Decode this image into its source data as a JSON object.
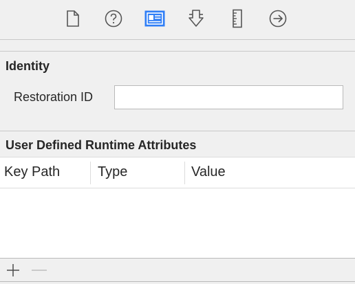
{
  "toolbar": {
    "icons": [
      {
        "name": "file-inspector-icon"
      },
      {
        "name": "quick-help-icon"
      },
      {
        "name": "identity-inspector-icon",
        "selected": true
      },
      {
        "name": "attributes-inspector-icon"
      },
      {
        "name": "size-inspector-icon"
      },
      {
        "name": "connections-inspector-icon"
      }
    ],
    "accent_color": "#2f7ef6"
  },
  "identity": {
    "title": "Identity",
    "restoration_label": "Restoration ID",
    "restoration_value": ""
  },
  "runtime_attributes": {
    "title": "User Defined Runtime Attributes",
    "columns": [
      "Key Path",
      "Type",
      "Value"
    ],
    "rows": []
  },
  "controls": {
    "add_symbol": "+",
    "remove_symbol": "−"
  }
}
